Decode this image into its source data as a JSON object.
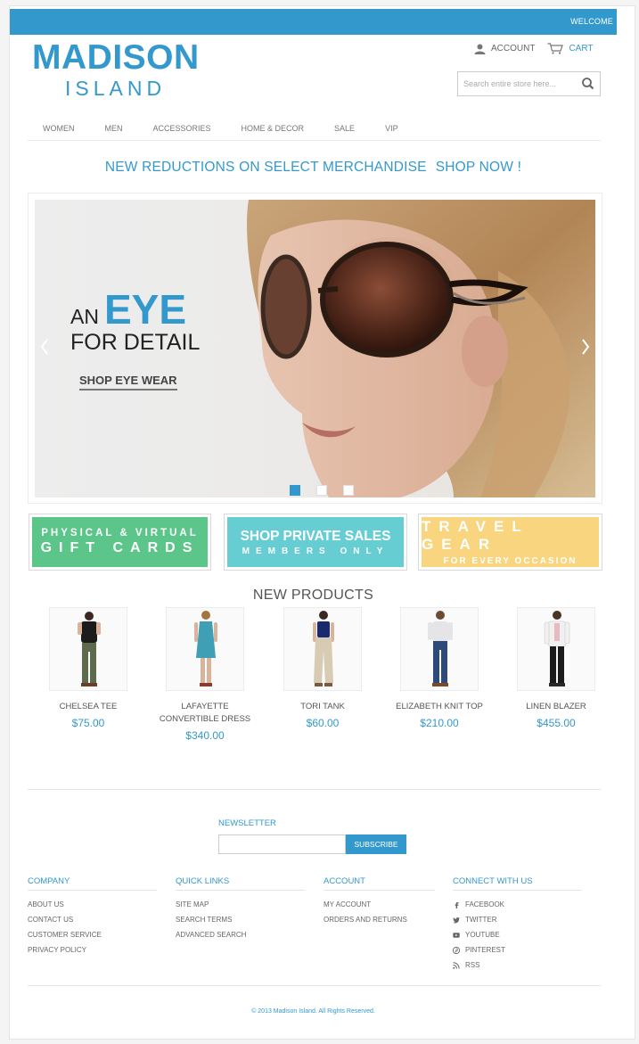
{
  "header": {
    "welcome": "WELCOME",
    "logo_top": "MADISON",
    "logo_bottom": "ISLAND",
    "account_label": "ACCOUNT",
    "cart_label": "CART",
    "search_placeholder": "Search entire store here..."
  },
  "nav": {
    "items": [
      {
        "label": "WOMEN"
      },
      {
        "label": "MEN"
      },
      {
        "label": "ACCESSORIES"
      },
      {
        "label": "HOME & DECOR"
      },
      {
        "label": "SALE"
      },
      {
        "label": "VIP"
      }
    ]
  },
  "promo": {
    "text": "NEW REDUCTIONS ON SELECT MERCHANDISE",
    "cta": "SHOP NOW !"
  },
  "slider": {
    "line1_small": "AN",
    "line1_big": "EYE",
    "line2": "FOR DETAIL",
    "cta": "SHOP EYE WEAR",
    "slide_count": 3,
    "active_slide": 1
  },
  "banners": [
    {
      "line1": "PHYSICAL & VIRTUAL",
      "line2": "GIFT CARDS"
    },
    {
      "line1": "SHOP PRIVATE SALES",
      "line2": "MEMBERS ONLY"
    },
    {
      "line1": "TRAVEL GEAR",
      "line2": "FOR EVERY OCCASION"
    }
  ],
  "new_products": {
    "title": "NEW PRODUCTS",
    "items": [
      {
        "name": "CHELSEA TEE",
        "price": "$75.00"
      },
      {
        "name": "LAFAYETTE CONVERTIBLE DRESS",
        "price": "$340.00"
      },
      {
        "name": "TORI TANK",
        "price": "$60.00"
      },
      {
        "name": "ELIZABETH KNIT TOP",
        "price": "$210.00"
      },
      {
        "name": "LINEN BLAZER",
        "price": "$455.00"
      }
    ]
  },
  "newsletter": {
    "title": "NEWSLETTER",
    "input_value": "",
    "button": "SUBSCRIBE"
  },
  "footer": {
    "company": {
      "title": "COMPANY",
      "links": [
        "ABOUT US",
        "CONTACT US",
        "CUSTOMER SERVICE",
        "PRIVACY POLICY"
      ]
    },
    "quick_links": {
      "title": "QUICK LINKS",
      "links": [
        "SITE MAP",
        "SEARCH TERMS",
        "ADVANCED SEARCH"
      ]
    },
    "account": {
      "title": "ACCOUNT",
      "links": [
        "MY ACCOUNT",
        "ORDERS AND RETURNS"
      ]
    },
    "connect": {
      "title": "CONNECT WITH US",
      "links": [
        "FACEBOOK",
        "TWITTER",
        "YOUTUBE",
        "PINTEREST",
        "RSS"
      ]
    },
    "copyright": "© 2013 Madison Island. All Rights Reserved."
  },
  "colors": {
    "brand": "#3399cc",
    "gift_banner": "#5cc58a",
    "private_sales_banner": "#66cdd3",
    "travel_banner": "#f8d57e"
  },
  "icons": [
    "user-icon",
    "cart-icon",
    "search-icon",
    "facebook-icon",
    "twitter-icon",
    "youtube-icon",
    "pinterest-icon",
    "rss-icon",
    "chevron-left-icon",
    "chevron-right-icon"
  ]
}
